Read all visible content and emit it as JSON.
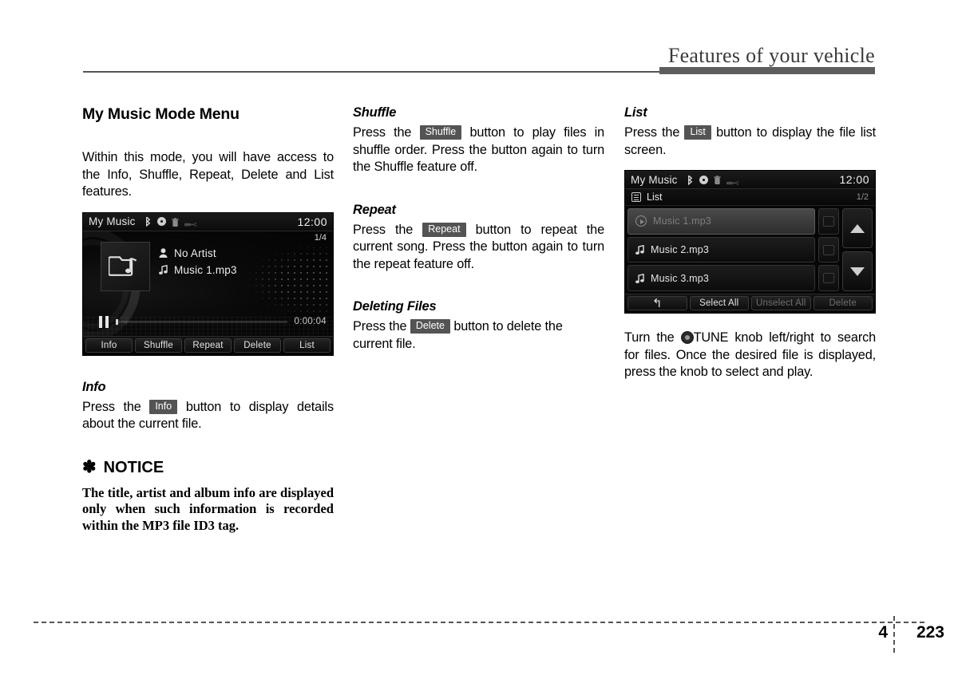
{
  "header": {
    "title": "Features of your vehicle"
  },
  "footer": {
    "chapter": "4",
    "page": "223"
  },
  "col1": {
    "section_title": "My Music Mode Menu",
    "intro": "Within this mode, you will have access to the Info, Shuffle, Repeat, Delete and List features.",
    "info": {
      "heading": "Info",
      "text_before": "Press the",
      "key": "Info",
      "text_after": "button to display details about the current file."
    },
    "notice": {
      "star": "✽",
      "heading": "NOTICE",
      "body": "The title, artist and album info are displayed only when such information is recorded within the MP3 file ID3 tag."
    }
  },
  "col2": {
    "shuffle": {
      "heading": "Shuffle",
      "text_before": "Press the",
      "key": "Shuffle",
      "text_after": "button to play files in shuffle order. Press the button again to turn the Shuffle feature off."
    },
    "repeat": {
      "heading": "Repeat",
      "text_before": "Press the",
      "key": "Repeat",
      "text_after": "button to repeat the current song. Press the button again to turn the repeat feature off."
    },
    "deleting": {
      "heading": "Deleting Files",
      "text_before": "Press the",
      "key": "Delete",
      "text_after": "button to delete the current file."
    }
  },
  "col3": {
    "list": {
      "heading": "List",
      "text_before": "Press the",
      "key": "List",
      "text_after": "button to display the file list screen."
    },
    "tune_text_before": "Turn the",
    "tune_label": "TUNE",
    "tune_text_after": "knob left/right to search for files. Once the desired file is displayed, press the knob to select and play."
  },
  "player_screen": {
    "title": "My Music",
    "clock": "12:00",
    "icons": [
      "bluetooth-icon",
      "disc-icon",
      "trash-icon",
      "usb-icon"
    ],
    "track_index": "1/4",
    "artist": "No Artist",
    "track_name": "Music 1.mp3",
    "elapsed": "0:00:04",
    "buttons": [
      "Info",
      "Shuffle",
      "Repeat",
      "Delete",
      "List"
    ]
  },
  "list_screen": {
    "title": "My Music",
    "clock": "12:00",
    "sub_label": "List",
    "page": "1/2",
    "rows": [
      {
        "name": "Music 1.mp3",
        "playing": true
      },
      {
        "name": "Music 2.mp3",
        "playing": false
      },
      {
        "name": "Music 3.mp3",
        "playing": false
      }
    ],
    "bottom_buttons": [
      {
        "label": "↰",
        "dim": false
      },
      {
        "label": "Select All",
        "dim": false
      },
      {
        "label": "Unselect All",
        "dim": true
      },
      {
        "label": "Delete",
        "dim": true
      }
    ]
  }
}
